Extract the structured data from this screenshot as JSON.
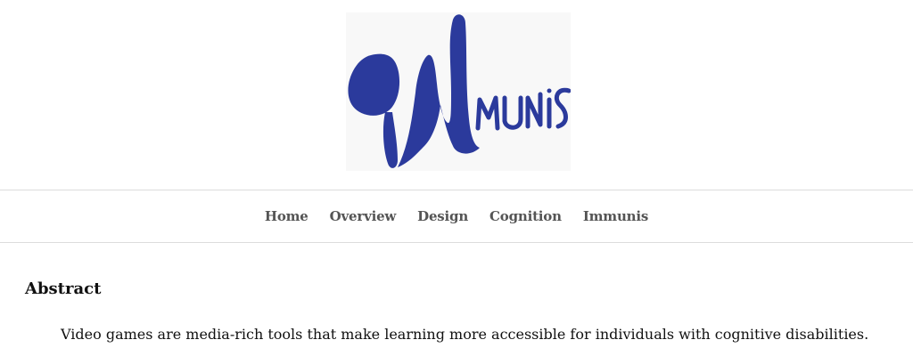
{
  "header": {
    "logo_text": "iMmunis"
  },
  "nav": {
    "items": [
      {
        "label": "Home"
      },
      {
        "label": "Overview"
      },
      {
        "label": "Design"
      },
      {
        "label": "Cognition"
      },
      {
        "label": "Immunis"
      }
    ]
  },
  "main": {
    "section_title": "Abstract",
    "abstract_text": "Video games are media-rich tools that make learning more accessible for individuals with cognitive disabilities."
  },
  "colors": {
    "logo_blue": "#2b3a9c",
    "nav_text": "#555555",
    "divider": "#dcdcdc"
  }
}
